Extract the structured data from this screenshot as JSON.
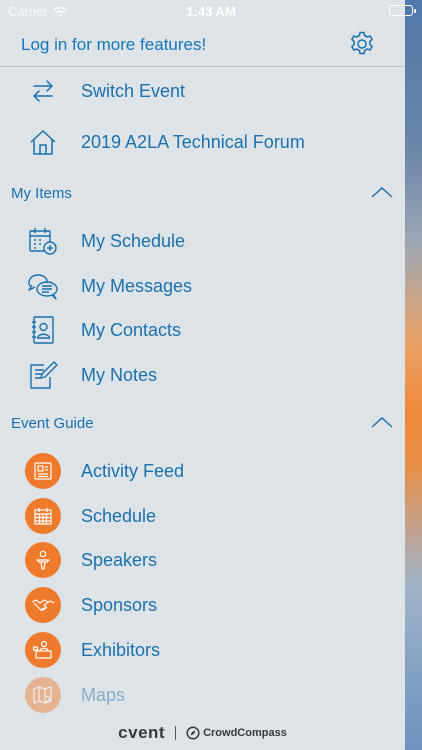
{
  "status": {
    "carrier": "Carrier",
    "time": "1:43 AM"
  },
  "header": {
    "login_text": "Log in for more features!",
    "settings_icon": "gear-icon"
  },
  "top_items": [
    {
      "label": "Switch Event",
      "icon": "swap-arrows-icon"
    },
    {
      "label": "2019 A2LA Technical Forum",
      "icon": "home-icon"
    }
  ],
  "my_items": {
    "title": "My Items",
    "items": [
      {
        "label": "My Schedule",
        "icon": "calendar-add-icon"
      },
      {
        "label": "My Messages",
        "icon": "chat-bubbles-icon"
      },
      {
        "label": "My Contacts",
        "icon": "contact-book-icon"
      },
      {
        "label": "My Notes",
        "icon": "note-pencil-icon"
      }
    ]
  },
  "event_guide": {
    "title": "Event Guide",
    "items": [
      {
        "label": "Activity Feed",
        "icon": "newspaper-icon"
      },
      {
        "label": "Schedule",
        "icon": "calendar-icon"
      },
      {
        "label": "Speakers",
        "icon": "speaker-podium-icon"
      },
      {
        "label": "Sponsors",
        "icon": "handshake-icon"
      },
      {
        "label": "Exhibitors",
        "icon": "exhibitor-booth-icon"
      },
      {
        "label": "Maps",
        "icon": "map-pin-icon"
      }
    ]
  },
  "footer": {
    "brand_left": "cvent",
    "brand_right": "CrowdCompass"
  },
  "colors": {
    "accent": "#1a71ad",
    "orange": "#ef7a2b",
    "background": "#dde3e6"
  }
}
